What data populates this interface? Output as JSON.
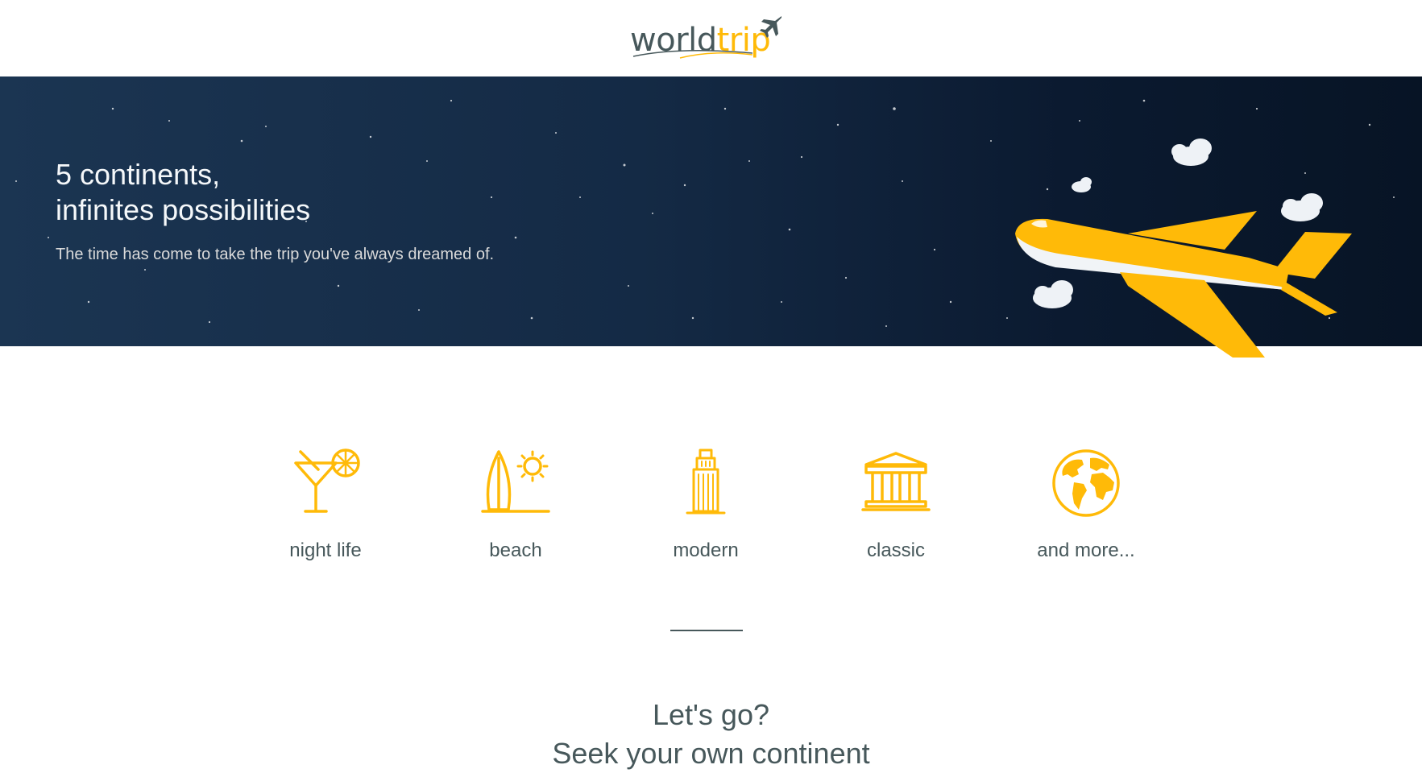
{
  "header": {
    "logo": {
      "word1": "world",
      "word2": "trip"
    }
  },
  "hero": {
    "title_line1": "5 continents,",
    "title_line2": "infinites possibilities",
    "subtitle": "The time has come to take the trip you've always dreamed of."
  },
  "types": [
    {
      "label": "night life",
      "icon": "cocktail-icon"
    },
    {
      "label": "beach",
      "icon": "surfboard-sun-icon"
    },
    {
      "label": "modern",
      "icon": "skyscraper-icon"
    },
    {
      "label": "classic",
      "icon": "museum-icon"
    },
    {
      "label": "and more...",
      "icon": "earth-globe-icon"
    }
  ],
  "cta": {
    "line1": "Let's go?",
    "line2": "Seek your own continent"
  },
  "colors": {
    "accent": "#FFBA08",
    "heading": "#47585B",
    "hero_bg": "#142a45",
    "hero_text": "#F5F8FA"
  }
}
